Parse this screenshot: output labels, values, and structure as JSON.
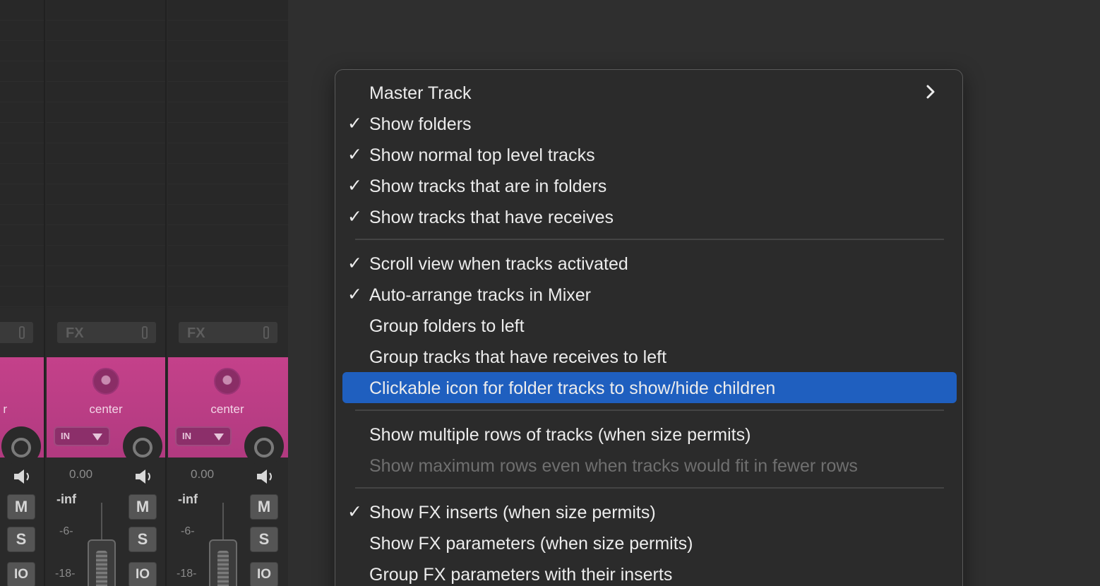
{
  "mixer": {
    "fx_label": "FX",
    "strips": [
      {
        "pan_label": "center",
        "input_label": "IN",
        "volume": "0.00",
        "peak": "-inf",
        "tick_1": "-6-",
        "tick_2": "-18-"
      },
      {
        "pan_label": "center",
        "input_label": "IN",
        "volume": "0.00",
        "peak": "-inf",
        "tick_1": "-6-",
        "tick_2": "-18-"
      }
    ],
    "partial_pan_label": "r",
    "mute_label": "M",
    "solo_label": "S",
    "io_label": "IO",
    "strip_color": "#c4418a"
  },
  "menu": {
    "items": [
      {
        "label": "Master Track",
        "checked": false,
        "submenu": true
      },
      {
        "label": "Show folders",
        "checked": true
      },
      {
        "label": "Show normal top level tracks",
        "checked": true
      },
      {
        "label": "Show tracks that are in folders",
        "checked": true
      },
      {
        "label": "Show tracks that have receives",
        "checked": true
      },
      {
        "label": "Scroll view when tracks activated",
        "checked": true
      },
      {
        "label": "Auto-arrange tracks in Mixer",
        "checked": true
      },
      {
        "label": "Group folders to left",
        "checked": false
      },
      {
        "label": "Group tracks that have receives to left",
        "checked": false
      },
      {
        "label": "Clickable icon for folder tracks to show/hide children",
        "checked": false,
        "highlighted": true
      },
      {
        "label": "Show multiple rows of tracks (when size permits)",
        "checked": false
      },
      {
        "label": "Show maximum rows even when tracks would fit in fewer rows",
        "checked": false,
        "disabled": true
      },
      {
        "label": "Show FX inserts (when size permits)",
        "checked": true
      },
      {
        "label": "Show FX parameters (when size permits)",
        "checked": false
      },
      {
        "label": "Group FX parameters with their inserts",
        "checked": false
      }
    ],
    "check_glyph": "✓",
    "highlight_color": "#1f5fbf"
  }
}
